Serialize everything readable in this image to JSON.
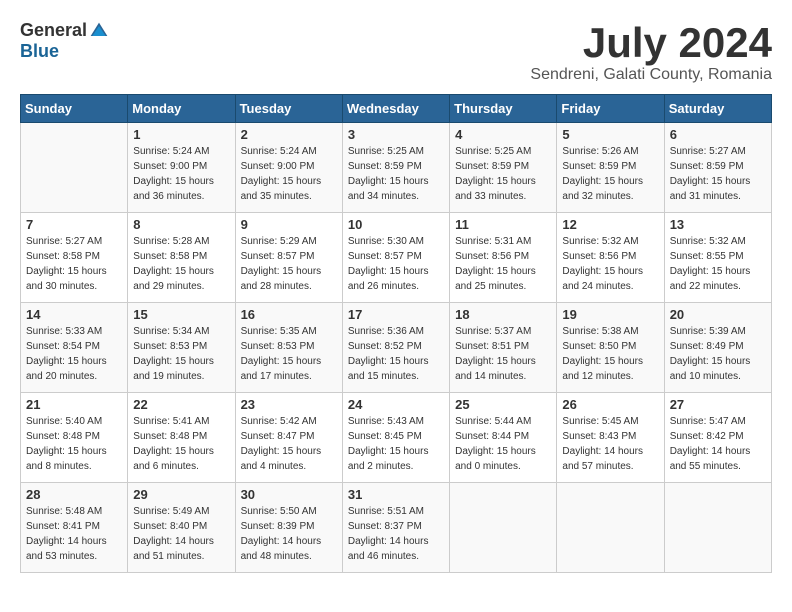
{
  "header": {
    "logo_general": "General",
    "logo_blue": "Blue",
    "title": "July 2024",
    "subtitle": "Sendreni, Galati County, Romania"
  },
  "days_of_week": [
    "Sunday",
    "Monday",
    "Tuesday",
    "Wednesday",
    "Thursday",
    "Friday",
    "Saturday"
  ],
  "weeks": [
    [
      {
        "day": "",
        "info": ""
      },
      {
        "day": "1",
        "info": "Sunrise: 5:24 AM\nSunset: 9:00 PM\nDaylight: 15 hours\nand 36 minutes."
      },
      {
        "day": "2",
        "info": "Sunrise: 5:24 AM\nSunset: 9:00 PM\nDaylight: 15 hours\nand 35 minutes."
      },
      {
        "day": "3",
        "info": "Sunrise: 5:25 AM\nSunset: 8:59 PM\nDaylight: 15 hours\nand 34 minutes."
      },
      {
        "day": "4",
        "info": "Sunrise: 5:25 AM\nSunset: 8:59 PM\nDaylight: 15 hours\nand 33 minutes."
      },
      {
        "day": "5",
        "info": "Sunrise: 5:26 AM\nSunset: 8:59 PM\nDaylight: 15 hours\nand 32 minutes."
      },
      {
        "day": "6",
        "info": "Sunrise: 5:27 AM\nSunset: 8:59 PM\nDaylight: 15 hours\nand 31 minutes."
      }
    ],
    [
      {
        "day": "7",
        "info": "Sunrise: 5:27 AM\nSunset: 8:58 PM\nDaylight: 15 hours\nand 30 minutes."
      },
      {
        "day": "8",
        "info": "Sunrise: 5:28 AM\nSunset: 8:58 PM\nDaylight: 15 hours\nand 29 minutes."
      },
      {
        "day": "9",
        "info": "Sunrise: 5:29 AM\nSunset: 8:57 PM\nDaylight: 15 hours\nand 28 minutes."
      },
      {
        "day": "10",
        "info": "Sunrise: 5:30 AM\nSunset: 8:57 PM\nDaylight: 15 hours\nand 26 minutes."
      },
      {
        "day": "11",
        "info": "Sunrise: 5:31 AM\nSunset: 8:56 PM\nDaylight: 15 hours\nand 25 minutes."
      },
      {
        "day": "12",
        "info": "Sunrise: 5:32 AM\nSunset: 8:56 PM\nDaylight: 15 hours\nand 24 minutes."
      },
      {
        "day": "13",
        "info": "Sunrise: 5:32 AM\nSunset: 8:55 PM\nDaylight: 15 hours\nand 22 minutes."
      }
    ],
    [
      {
        "day": "14",
        "info": "Sunrise: 5:33 AM\nSunset: 8:54 PM\nDaylight: 15 hours\nand 20 minutes."
      },
      {
        "day": "15",
        "info": "Sunrise: 5:34 AM\nSunset: 8:53 PM\nDaylight: 15 hours\nand 19 minutes."
      },
      {
        "day": "16",
        "info": "Sunrise: 5:35 AM\nSunset: 8:53 PM\nDaylight: 15 hours\nand 17 minutes."
      },
      {
        "day": "17",
        "info": "Sunrise: 5:36 AM\nSunset: 8:52 PM\nDaylight: 15 hours\nand 15 minutes."
      },
      {
        "day": "18",
        "info": "Sunrise: 5:37 AM\nSunset: 8:51 PM\nDaylight: 15 hours\nand 14 minutes."
      },
      {
        "day": "19",
        "info": "Sunrise: 5:38 AM\nSunset: 8:50 PM\nDaylight: 15 hours\nand 12 minutes."
      },
      {
        "day": "20",
        "info": "Sunrise: 5:39 AM\nSunset: 8:49 PM\nDaylight: 15 hours\nand 10 minutes."
      }
    ],
    [
      {
        "day": "21",
        "info": "Sunrise: 5:40 AM\nSunset: 8:48 PM\nDaylight: 15 hours\nand 8 minutes."
      },
      {
        "day": "22",
        "info": "Sunrise: 5:41 AM\nSunset: 8:48 PM\nDaylight: 15 hours\nand 6 minutes."
      },
      {
        "day": "23",
        "info": "Sunrise: 5:42 AM\nSunset: 8:47 PM\nDaylight: 15 hours\nand 4 minutes."
      },
      {
        "day": "24",
        "info": "Sunrise: 5:43 AM\nSunset: 8:45 PM\nDaylight: 15 hours\nand 2 minutes."
      },
      {
        "day": "25",
        "info": "Sunrise: 5:44 AM\nSunset: 8:44 PM\nDaylight: 15 hours\nand 0 minutes."
      },
      {
        "day": "26",
        "info": "Sunrise: 5:45 AM\nSunset: 8:43 PM\nDaylight: 14 hours\nand 57 minutes."
      },
      {
        "day": "27",
        "info": "Sunrise: 5:47 AM\nSunset: 8:42 PM\nDaylight: 14 hours\nand 55 minutes."
      }
    ],
    [
      {
        "day": "28",
        "info": "Sunrise: 5:48 AM\nSunset: 8:41 PM\nDaylight: 14 hours\nand 53 minutes."
      },
      {
        "day": "29",
        "info": "Sunrise: 5:49 AM\nSunset: 8:40 PM\nDaylight: 14 hours\nand 51 minutes."
      },
      {
        "day": "30",
        "info": "Sunrise: 5:50 AM\nSunset: 8:39 PM\nDaylight: 14 hours\nand 48 minutes."
      },
      {
        "day": "31",
        "info": "Sunrise: 5:51 AM\nSunset: 8:37 PM\nDaylight: 14 hours\nand 46 minutes."
      },
      {
        "day": "",
        "info": ""
      },
      {
        "day": "",
        "info": ""
      },
      {
        "day": "",
        "info": ""
      }
    ]
  ]
}
